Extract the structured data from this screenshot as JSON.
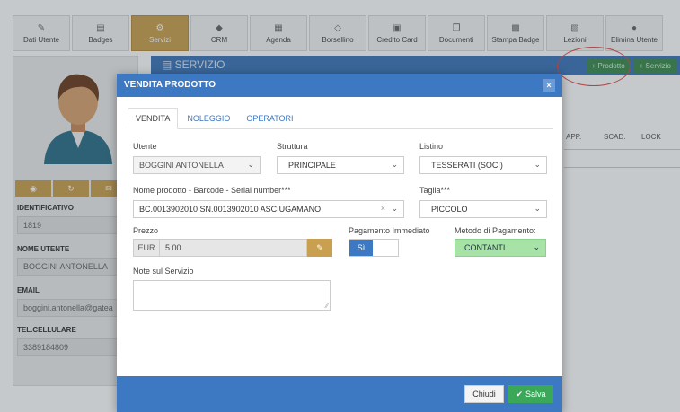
{
  "toolbar": {
    "items": [
      {
        "label": "Dati Utente",
        "icon": "edit-icon"
      },
      {
        "label": "Badges",
        "icon": "badge-icon"
      },
      {
        "label": "Servizi",
        "icon": "services-icon",
        "active": true
      },
      {
        "label": "CRM",
        "icon": "tag-icon"
      },
      {
        "label": "Agenda",
        "icon": "calendar-icon"
      },
      {
        "label": "Borsellino",
        "icon": "diamond-icon"
      },
      {
        "label": "Credito Card",
        "icon": "credit-card-icon"
      },
      {
        "label": "Documenti",
        "icon": "documents-icon"
      },
      {
        "label": "Stampa Badge",
        "icon": "image-icon"
      },
      {
        "label": "Lezioni",
        "icon": "chart-icon"
      },
      {
        "label": "Elimina Utente",
        "icon": "delete-icon"
      }
    ]
  },
  "profile": {
    "identificativo_label": "IDENTIFICATIVO",
    "identificativo": "1819",
    "nome_label": "NOME UTENTE",
    "nome": "BOGGINI ANTONELLA",
    "email_label": "EMAIL",
    "email": "boggini.antonella@gatea",
    "tel_label": "TEL.CELLULARE",
    "tel": "3389184809"
  },
  "servizio": {
    "title": "SERVIZIO",
    "prodotto_btn": "+ Prodotto",
    "servizio_btn": "+ Servizio",
    "columns": [
      "APP.",
      "SCAD.",
      "LOCK"
    ]
  },
  "modal": {
    "title": "VENDITA PRODOTTO",
    "close": "×",
    "tabs": [
      "VENDITA",
      "NOLEGGIO",
      "OPERATORI"
    ],
    "utente_label": "Utente",
    "utente_value": "BOGGINI ANTONELLA",
    "struttura_label": "Struttura",
    "struttura_value": "PRINCIPALE",
    "listino_label": "Listino",
    "listino_value": "TESSERATI (SOCI)",
    "nome_prodotto_label": "Nome prodotto - Barcode - Serial number***",
    "nome_prodotto_value": "BC.0013902010 SN.0013902010 ASCIUGAMANO",
    "taglia_label": "Taglia***",
    "taglia_value": "PICCOLO",
    "prezzo_label": "Prezzo",
    "prezzo_currency": "EUR",
    "prezzo_value": "5.00",
    "pagamento_label": "Pagamento Immediato",
    "pagamento_toggle": "Sì",
    "metodo_label": "Metodo di Pagamento:",
    "metodo_value": "CONTANTI",
    "note_label": "Note sul Servizio",
    "chiudi": "Chiudi",
    "salva": "Salva"
  },
  "colors": {
    "primary": "#3d78c3",
    "gold": "#c9a050",
    "success": "#3aa858",
    "metodo_bg": "#a7e3a7"
  }
}
